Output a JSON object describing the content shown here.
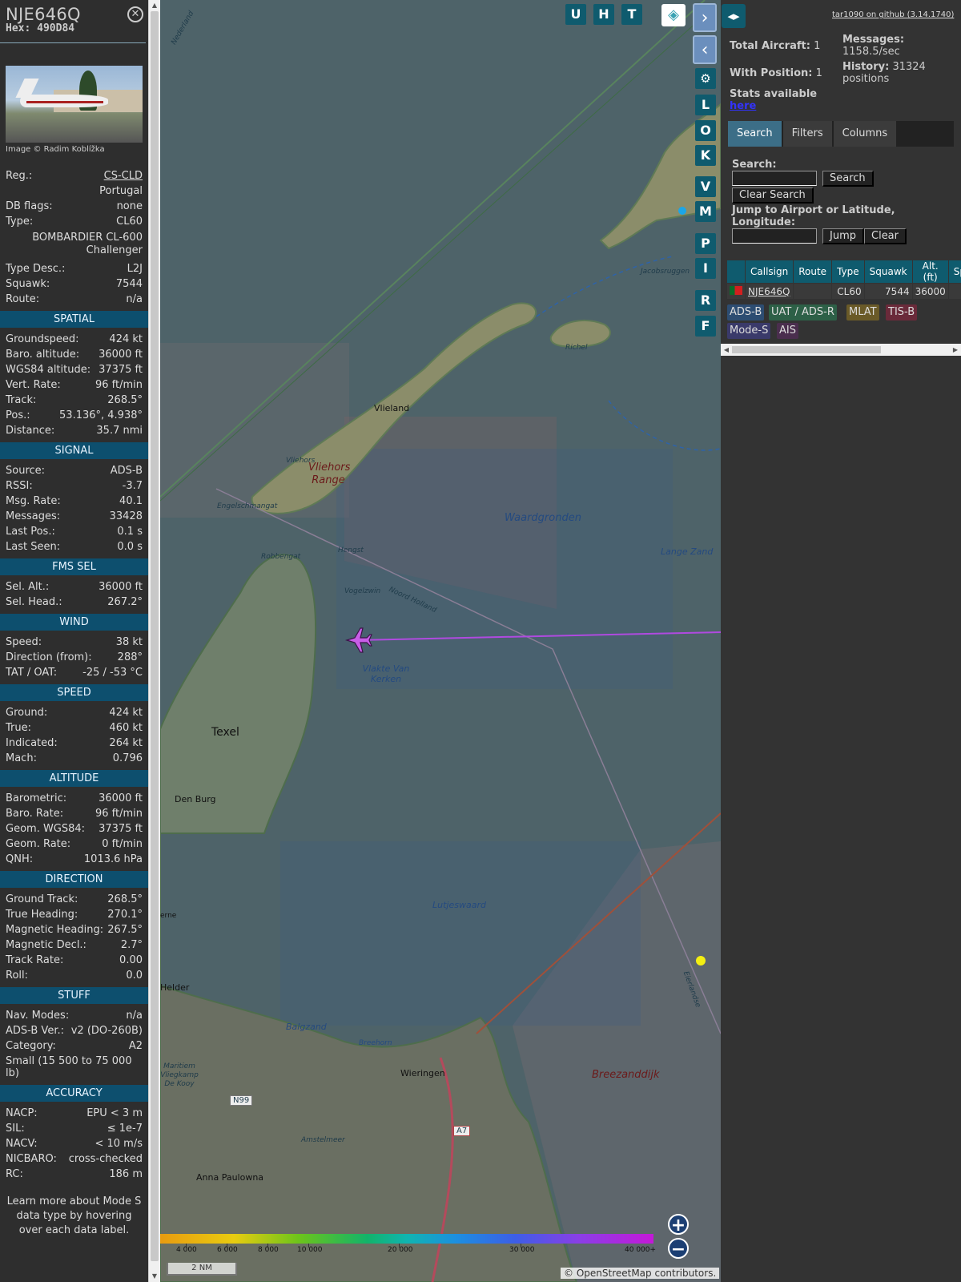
{
  "aircraft": {
    "callsign": "NJE646Q",
    "hex": "Hex: 490D84",
    "photo_credit": "Image © Radim Koblížka"
  },
  "details": [
    {
      "k": "Reg.:",
      "v": "CS-CLD",
      "link": true
    },
    {
      "v": "Portugal"
    },
    {
      "k": "DB flags:",
      "v": "none"
    },
    {
      "k": "Type:",
      "v": "CL60"
    },
    {
      "v": "BOMBARDIER CL-600 Challenger",
      "tall": true
    },
    {
      "k": "Type Desc.:",
      "v": "L2J"
    },
    {
      "k": "Squawk:",
      "v": "7544"
    },
    {
      "k": "Route:",
      "v": "n/a"
    }
  ],
  "sections": [
    {
      "title": "SPATIAL",
      "rows": [
        [
          "Groundspeed:",
          "424 kt"
        ],
        [
          "Baro. altitude:",
          "36000 ft"
        ],
        [
          "WGS84 altitude:",
          "37375 ft"
        ],
        [
          "Vert. Rate:",
          "96 ft/min"
        ],
        [
          "Track:",
          "268.5°"
        ],
        [
          "Pos.:",
          "53.136°, 4.938°"
        ],
        [
          "Distance:",
          "35.7 nmi"
        ]
      ]
    },
    {
      "title": "SIGNAL",
      "rows": [
        [
          "Source:",
          "ADS-B"
        ],
        [
          "RSSI:",
          "-3.7"
        ],
        [
          "Msg. Rate:",
          "40.1"
        ],
        [
          "Messages:",
          "33428"
        ],
        [
          "Last Pos.:",
          "0.1 s"
        ],
        [
          "Last Seen:",
          "0.0 s"
        ]
      ]
    },
    {
      "title": "FMS SEL",
      "rows": [
        [
          "Sel. Alt.:",
          "36000 ft"
        ],
        [
          "Sel. Head.:",
          "267.2°"
        ]
      ]
    },
    {
      "title": "WIND",
      "rows": [
        [
          "Speed:",
          "38 kt"
        ],
        [
          "Direction (from):",
          "288°"
        ],
        [
          "TAT / OAT:",
          "-25 / -53 °C"
        ]
      ]
    },
    {
      "title": "SPEED",
      "rows": [
        [
          "Ground:",
          "424 kt"
        ],
        [
          "True:",
          "460 kt"
        ],
        [
          "Indicated:",
          "264 kt"
        ],
        [
          "Mach:",
          "0.796"
        ]
      ]
    },
    {
      "title": "ALTITUDE",
      "rows": [
        [
          "Barometric:",
          "36000 ft"
        ],
        [
          "Baro. Rate:",
          "96 ft/min"
        ],
        [
          "Geom. WGS84:",
          "37375 ft"
        ],
        [
          "Geom. Rate:",
          "0 ft/min"
        ],
        [
          "QNH:",
          "1013.6 hPa"
        ]
      ]
    },
    {
      "title": "DIRECTION",
      "rows": [
        [
          "Ground Track:",
          "268.5°"
        ],
        [
          "True Heading:",
          "270.1°"
        ],
        [
          "Magnetic Heading:",
          "267.5°"
        ],
        [
          "Magnetic Decl.:",
          "2.7°"
        ],
        [
          "Track Rate:",
          "0.00"
        ],
        [
          "Roll:",
          "0.0"
        ]
      ]
    },
    {
      "title": "STUFF",
      "rows": [
        [
          "Nav. Modes:",
          "n/a"
        ],
        [
          "ADS-B Ver.:",
          "v2 (DO-260B)"
        ],
        [
          "Category:",
          "A2"
        ],
        [
          "Small (15 500 to 75 000 lb)",
          ""
        ]
      ]
    },
    {
      "title": "ACCURACY",
      "rows": [
        [
          "NACP:",
          "EPU < 3 m"
        ],
        [
          "SIL:",
          "≤ 1e-7"
        ],
        [
          "NACV:",
          "< 10 m/s"
        ],
        [
          "NICBARO:",
          "cross-checked"
        ],
        [
          "RC:",
          "186 m"
        ]
      ]
    }
  ],
  "learn_more": "Learn more about Mode S data type by hovering over each data label.",
  "map": {
    "buttons": [
      "U",
      "H",
      "T"
    ],
    "side_buttons": [
      "L",
      "O",
      "K",
      "V",
      "M",
      "P",
      "I",
      "R",
      "F"
    ],
    "labels": [
      {
        "t": "Vlieland"
      },
      {
        "t": "Vliehors"
      },
      {
        "t": "Vliehors Range"
      },
      {
        "t": "Waardgronden"
      },
      {
        "t": "Engelschmangat"
      },
      {
        "t": "Robbengat"
      },
      {
        "t": "Hengst"
      },
      {
        "t": "Vogelzwin"
      },
      {
        "t": "Noord Holland"
      },
      {
        "t": "Vlakte Van Kerken"
      },
      {
        "t": "Lange Zand"
      },
      {
        "t": "Richel"
      },
      {
        "t": "Jacobsruggen"
      },
      {
        "t": "Texel"
      },
      {
        "t": "Den Burg"
      },
      {
        "t": "Lutjeswaard"
      },
      {
        "t": "Balgzand"
      },
      {
        "t": "Breehorn"
      },
      {
        "t": "Wieringen"
      },
      {
        "t": "Breezanddijk"
      },
      {
        "t": "Maritiem Vliegkamp De Kooy"
      },
      {
        "t": "Amstelmeer"
      },
      {
        "t": "Anna Paulowna"
      },
      {
        "t": "Nederland"
      },
      {
        "t": "Eierlandse"
      },
      {
        "t": "N99"
      },
      {
        "t": "A7"
      },
      {
        "t": "Helder"
      },
      {
        "t": "erne"
      }
    ],
    "colorbar_labels": [
      "4 000",
      "6 000",
      "8 000",
      "10 000",
      "20 000",
      "30 000",
      "40 000+"
    ],
    "scale": "2 NM",
    "attribution": "© OpenStreetMap contributors."
  },
  "panel": {
    "github": "tar1090 on github (3.14.1740)",
    "total_aircraft_label": "Total Aircraft:",
    "total_aircraft": "1",
    "with_position_label": "With Position:",
    "with_position": "1",
    "messages_label": "Messages:",
    "messages": "1158.5/sec",
    "history_label": "History:",
    "history": "31324 positions",
    "stats_label": "Stats available",
    "stats_link": "here",
    "tabs": [
      "Search",
      "Filters",
      "Columns"
    ],
    "search_label": "Search:",
    "search_btn": "Search",
    "clear_search_btn": "Clear Search",
    "jump_label": "Jump to Airport or Latitude, Longitude:",
    "jump_btn": "Jump",
    "clear_btn": "Clear",
    "table_headers": [
      "",
      "Callsign",
      "Route",
      "Type",
      "Squawk",
      "Alt. (ft)",
      "Spd"
    ],
    "table_rows": [
      [
        "",
        "NJE646Q",
        "",
        "CL60",
        "7544",
        "36000",
        ""
      ]
    ],
    "sources": [
      {
        "t": "ADS-B",
        "bg": "#2d4d72",
        "fg": "#ddd"
      },
      {
        "t": "UAT / ADS-R",
        "bg": "#2d6047",
        "fg": "#ddd"
      },
      {
        "t": "MLAT",
        "bg": "#6a5a28",
        "fg": "#ddd"
      },
      {
        "t": "TIS-B",
        "bg": "#6a2a3a",
        "fg": "#ddd"
      },
      {
        "t": "Mode-S",
        "bg": "#3a3a6a",
        "fg": "#ddd"
      },
      {
        "t": "AIS",
        "bg": "#4a2e4e",
        "fg": "#ddd"
      }
    ]
  }
}
